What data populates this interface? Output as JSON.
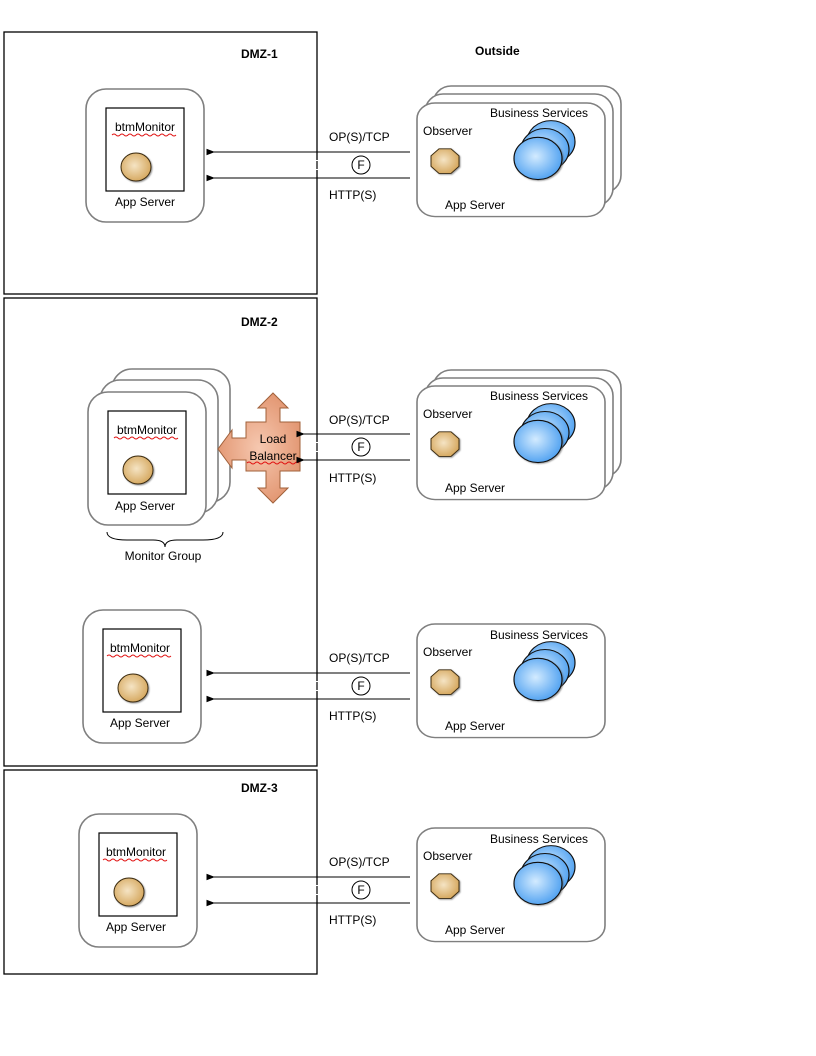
{
  "diagram": {
    "outside_label": "Outside",
    "colors": {
      "monitor_orb": "#d9ae66",
      "observer": "#d4a85e",
      "business_orb": "#5aa8f2",
      "load_balancer": "#e09470",
      "card_border": "#7f7f7f"
    },
    "zones": [
      {
        "title": "DMZ-1"
      },
      {
        "title": "DMZ-2"
      },
      {
        "title": "DMZ-3"
      }
    ],
    "monitors": [
      {
        "component": "btmMonitor",
        "container": "App Server"
      },
      {
        "component": "btmMonitor",
        "container": "App Server",
        "group_label": "Monitor Group"
      },
      {
        "component": "btmMonitor",
        "container": "App Server"
      },
      {
        "component": "btmMonitor",
        "container": "App Server"
      }
    ],
    "load_balancer": {
      "line1": "Load",
      "line2": "Balancer"
    },
    "connections": [
      {
        "top": "OP(S)/TCP",
        "middle": "F",
        "bottom": "HTTP(S)"
      },
      {
        "top": "OP(S)/TCP",
        "middle": "F",
        "bottom": "HTTP(S)"
      },
      {
        "top": "OP(S)/TCP",
        "middle": "F",
        "bottom": "HTTP(S)"
      },
      {
        "top": "OP(S)/TCP",
        "middle": "F",
        "bottom": "HTTP(S)"
      }
    ],
    "outside_servers": [
      {
        "services": "Business Services",
        "observer": "Observer",
        "container": "App Server"
      },
      {
        "services": "Business Services",
        "observer": "Observer",
        "container": "App Server"
      },
      {
        "services": "Business Services",
        "observer": "Observer",
        "container": "App Server"
      },
      {
        "services": "Business Services",
        "observer": "Observer",
        "container": "App Server"
      }
    ]
  }
}
